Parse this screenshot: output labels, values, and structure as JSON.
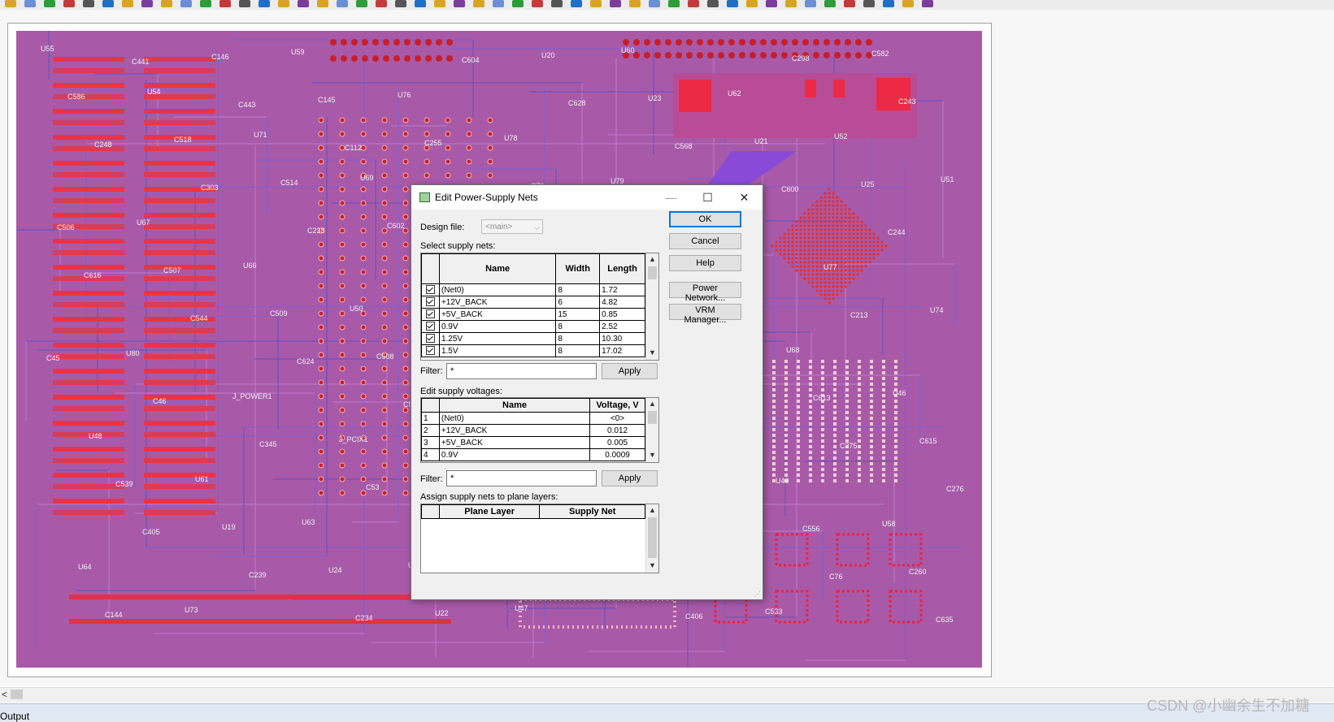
{
  "dialog": {
    "title": "Edit Power-Supply Nets",
    "design_file_label": "Design file:",
    "design_file_value": "<main>",
    "select_supply_label": "Select supply nets:",
    "supply_nets": {
      "headers": [
        "Name",
        "Width",
        "Length"
      ],
      "rows": [
        {
          "checked": true,
          "name": "(Net0)",
          "width": "8",
          "length": "1.72"
        },
        {
          "checked": true,
          "name": "+12V_BACK",
          "width": "6",
          "length": "4.82"
        },
        {
          "checked": true,
          "name": "+5V_BACK",
          "width": "15",
          "length": "0.85"
        },
        {
          "checked": true,
          "name": "0.9V",
          "width": "8",
          "length": "2.52"
        },
        {
          "checked": true,
          "name": "1.25V",
          "width": "8",
          "length": "10.30"
        },
        {
          "checked": true,
          "name": "1.5V",
          "width": "8",
          "length": "17.02"
        }
      ]
    },
    "filter1_label": "Filter:",
    "filter1_value": "*",
    "apply1_label": "Apply",
    "edit_voltages_label": "Edit supply voltages:",
    "voltages": {
      "headers": [
        "Name",
        "Voltage, V"
      ],
      "rows": [
        {
          "num": "1",
          "name": "(Net0)",
          "voltage": "<0>"
        },
        {
          "num": "2",
          "name": "+12V_BACK",
          "voltage": "0.012"
        },
        {
          "num": "3",
          "name": "+5V_BACK",
          "voltage": "0.005"
        },
        {
          "num": "4",
          "name": "0.9V",
          "voltage": "0.0009"
        }
      ]
    },
    "filter2_label": "Filter:",
    "filter2_value": "*",
    "apply2_label": "Apply",
    "assign_label": "Assign supply nets to plane layers:",
    "planes": {
      "headers": [
        "Plane Layer",
        "Supply Net"
      ]
    },
    "buttons": {
      "ok": "OK",
      "cancel": "Cancel",
      "help": "Help",
      "power_network": "Power Network...",
      "vrm_manager": "VRM Manager..."
    }
  },
  "board_labels": [
    {
      "text": "U55"
    },
    {
      "text": "U54"
    },
    {
      "text": "U71"
    },
    {
      "text": "U69"
    },
    {
      "text": "U56"
    },
    {
      "text": "U53"
    },
    {
      "text": "U70"
    },
    {
      "text": "U68"
    },
    {
      "text": "U46"
    },
    {
      "text": "U48"
    },
    {
      "text": "U61"
    },
    {
      "text": "U63"
    },
    {
      "text": "U45"
    },
    {
      "text": "U47"
    },
    {
      "text": "U60"
    },
    {
      "text": "U62"
    },
    {
      "text": "U52"
    },
    {
      "text": "U51"
    },
    {
      "text": "U67"
    },
    {
      "text": "U66"
    },
    {
      "text": "U50"
    },
    {
      "text": "U57"
    },
    {
      "text": "U65"
    },
    {
      "text": "U72"
    },
    {
      "text": "U49"
    },
    {
      "text": "U58"
    },
    {
      "text": "U64"
    },
    {
      "text": "U73"
    },
    {
      "text": "U59"
    },
    {
      "text": "U76"
    },
    {
      "text": "U78"
    },
    {
      "text": "U79"
    },
    {
      "text": "U75"
    },
    {
      "text": "U77"
    },
    {
      "text": "U74"
    },
    {
      "text": "U80"
    },
    {
      "text": "J_POWER1"
    },
    {
      "text": "J_PCIX1"
    },
    {
      "text": "C530"
    },
    {
      "text": "C558"
    },
    {
      "text": "C622"
    },
    {
      "text": "C533"
    },
    {
      "text": "C582"
    },
    {
      "text": "C586"
    },
    {
      "text": "C518"
    },
    {
      "text": "C514"
    },
    {
      "text": "C602"
    },
    {
      "text": "C610"
    },
    {
      "text": "C592"
    },
    {
      "text": "C567"
    },
    {
      "text": "C613"
    },
    {
      "text": "C615"
    },
    {
      "text": "C539"
    },
    {
      "text": "U19"
    },
    {
      "text": "U24"
    },
    {
      "text": "U22"
    },
    {
      "text": "U20"
    },
    {
      "text": "U23"
    },
    {
      "text": "U21"
    },
    {
      "text": "U25"
    },
    {
      "text": "C506"
    },
    {
      "text": "C507"
    },
    {
      "text": "C509"
    },
    {
      "text": "C508"
    },
    {
      "text": "C237"
    },
    {
      "text": "C149"
    },
    {
      "text": "C636"
    },
    {
      "text": "C556"
    },
    {
      "text": "C260"
    },
    {
      "text": "C144"
    },
    {
      "text": "C146"
    },
    {
      "text": "C145"
    },
    {
      "text": "C255"
    },
    {
      "text": "C71"
    },
    {
      "text": "C288"
    },
    {
      "text": "C596"
    },
    {
      "text": "C213"
    },
    {
      "text": "C45"
    },
    {
      "text": "C46"
    },
    {
      "text": "C345"
    },
    {
      "text": "C53"
    },
    {
      "text": "C375"
    },
    {
      "text": "C277"
    },
    {
      "text": "C406"
    },
    {
      "text": "C298"
    },
    {
      "text": "C243"
    },
    {
      "text": "C248"
    },
    {
      "text": "C303"
    },
    {
      "text": "C238"
    },
    {
      "text": "C293"
    },
    {
      "text": "C403"
    },
    {
      "text": "C393"
    },
    {
      "text": "C404"
    },
    {
      "text": "C275"
    },
    {
      "text": "C276"
    },
    {
      "text": "C405"
    },
    {
      "text": "C239"
    },
    {
      "text": "C234"
    },
    {
      "text": "C604"
    },
    {
      "text": "C628"
    },
    {
      "text": "C568"
    },
    {
      "text": "C600"
    },
    {
      "text": "C244"
    },
    {
      "text": "C616"
    },
    {
      "text": "C544"
    },
    {
      "text": "C624"
    },
    {
      "text": "C97"
    },
    {
      "text": "C388"
    },
    {
      "text": "D28"
    },
    {
      "text": "C55"
    },
    {
      "text": "C76"
    },
    {
      "text": "C635"
    },
    {
      "text": "C441"
    },
    {
      "text": "C443"
    },
    {
      "text": "C112"
    },
    {
      "text": "XP1"
    }
  ]
}
